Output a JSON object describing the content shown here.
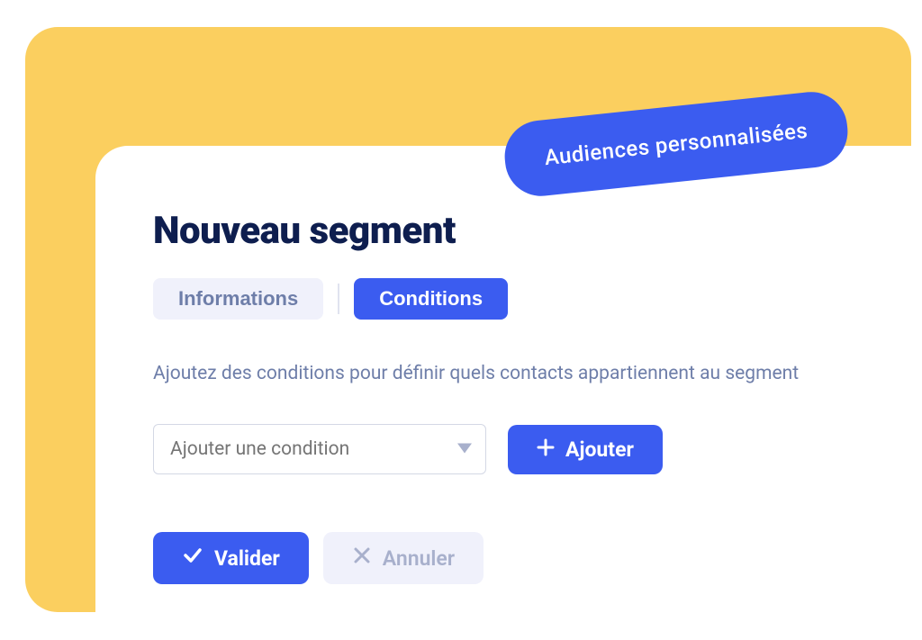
{
  "badge": {
    "label": "Audiences personnalisées"
  },
  "page": {
    "title": "Nouveau segment"
  },
  "tabs": {
    "informations": "Informations",
    "conditions": "Conditions"
  },
  "description": "Ajoutez des conditions pour définir quels contacts appartiennent au segment",
  "conditionSelect": {
    "placeholder": "Ajouter une condition"
  },
  "buttons": {
    "add": "Ajouter",
    "validate": "Valider",
    "cancel": "Annuler"
  }
}
